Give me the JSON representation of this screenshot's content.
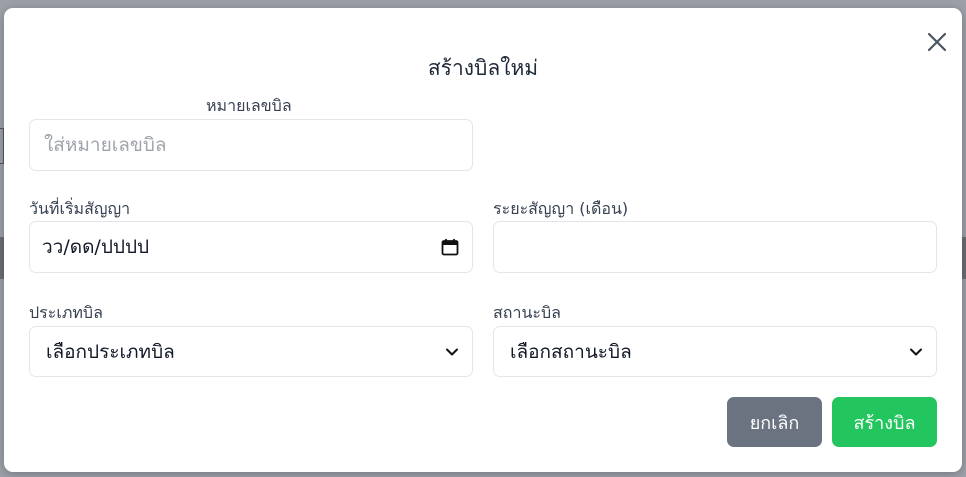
{
  "modal": {
    "title": "สร้างบิลใหม่",
    "close_icon": "close-icon"
  },
  "form": {
    "bill_number": {
      "label": "หมายเลขบิล",
      "value": "",
      "placeholder": "ใส่หมายเลขบิล"
    },
    "contract_start": {
      "label": "วันที่เริ่มสัญญา",
      "value": "วว/ดด/ปปปป",
      "icon": "calendar-icon"
    },
    "contract_period": {
      "label": "ระยะสัญญา (เดือน)",
      "value": ""
    },
    "bill_type": {
      "label": "ประเภทบิล",
      "selected": "เลือกประเภทบิล",
      "icon": "chevron-down-icon"
    },
    "bill_status": {
      "label": "สถานะบิล",
      "selected": "เลือกสถานะบิล",
      "icon": "chevron-down-icon"
    }
  },
  "actions": {
    "cancel_label": "ยกเลิก",
    "create_label": "สร้างบิล"
  },
  "colors": {
    "overlay": "#9ca0a8",
    "cancel_button": "#6b7280",
    "create_button": "#22c55e",
    "title_text": "#1f2937"
  }
}
